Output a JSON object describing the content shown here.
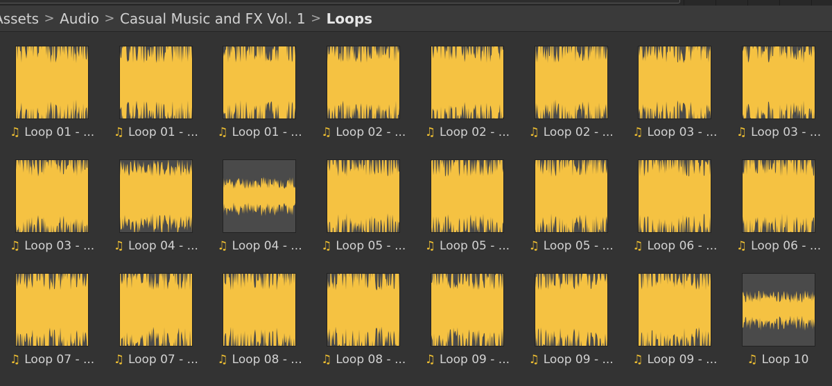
{
  "breadcrumb": {
    "items": [
      "Assets",
      "Audio",
      "Casual Music and FX Vol. 1",
      "Loops"
    ],
    "separator": ">"
  },
  "colors": {
    "waveform": "#f5c242",
    "thumb_bg": "#4a4a4a",
    "icon": "#f0c032"
  },
  "asset_icon": "music-note-icon",
  "assets": [
    {
      "label": "Loop 01 - ..."
    },
    {
      "label": "Loop 01 - ..."
    },
    {
      "label": "Loop 01 - ..."
    },
    {
      "label": "Loop 02 - ..."
    },
    {
      "label": "Loop 02 - ..."
    },
    {
      "label": "Loop 02 - ..."
    },
    {
      "label": "Loop 03 - ..."
    },
    {
      "label": "Loop 03 - ..."
    },
    {
      "label": "Loop 03 - ..."
    },
    {
      "label": "Loop 04 - ..."
    },
    {
      "label": "Loop 04 - ..."
    },
    {
      "label": "Loop 05 - ..."
    },
    {
      "label": "Loop 05 - ..."
    },
    {
      "label": "Loop 05 - ..."
    },
    {
      "label": "Loop 06 - ..."
    },
    {
      "label": "Loop 06 - ..."
    },
    {
      "label": "Loop 07 - ..."
    },
    {
      "label": "Loop 07 - ..."
    },
    {
      "label": "Loop 08 - ..."
    },
    {
      "label": "Loop 08 - ..."
    },
    {
      "label": "Loop 09 - ..."
    },
    {
      "label": "Loop 09 - ..."
    },
    {
      "label": "Loop 09 - ..."
    },
    {
      "label": "Loop 10"
    }
  ]
}
